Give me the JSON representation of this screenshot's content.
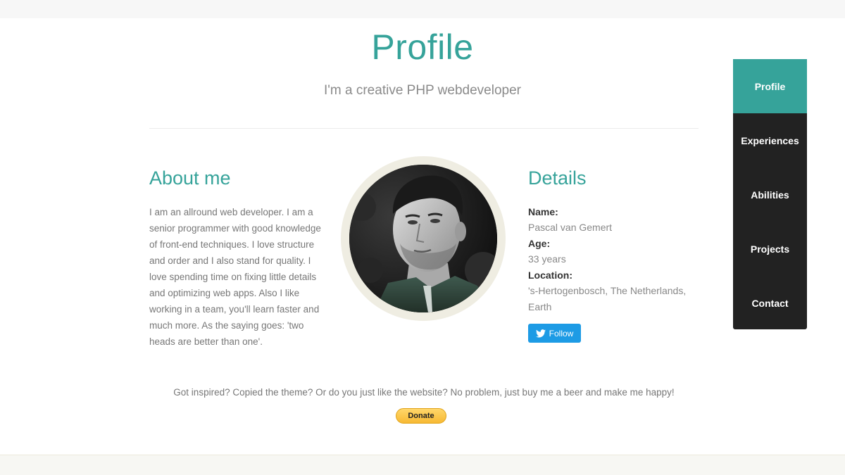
{
  "header": {
    "title": "Profile",
    "subtitle": "I'm a creative PHP webdeveloper"
  },
  "about": {
    "heading": "About me",
    "text": "I am an allround web developer. I am a senior programmer with good knowledge of front-end techniques. I love structure and order and I also stand for quality. I love spending time on fixing little details and optimizing web apps. Also I like working in a team, you'll learn faster and much more. As the saying goes: 'two heads are better than one'."
  },
  "details": {
    "heading": "Details",
    "name_label": "Name:",
    "name_value": "Pascal van Gemert",
    "age_label": "Age:",
    "age_value": "33 years",
    "location_label": "Location:",
    "location_value": "'s-Hertogenbosch, The Netherlands, Earth",
    "follow_label": "Follow"
  },
  "footer": {
    "message": "Got inspired? Copied the theme? Or do you just like the website? No problem, just buy me a beer and make me happy!",
    "donate_label": "Donate"
  },
  "nav": {
    "items": [
      {
        "label": "Profile",
        "active": true
      },
      {
        "label": "Experiences",
        "active": false
      },
      {
        "label": "Abilities",
        "active": false
      },
      {
        "label": "Projects",
        "active": false
      },
      {
        "label": "Contact",
        "active": false
      }
    ]
  },
  "colors": {
    "accent": "#36a39a",
    "nav_bg": "#222222",
    "twitter": "#1d9be5",
    "donate": "#f7b933"
  },
  "icons": {
    "follow": "twitter-bird-icon",
    "avatar": "profile-photo"
  }
}
